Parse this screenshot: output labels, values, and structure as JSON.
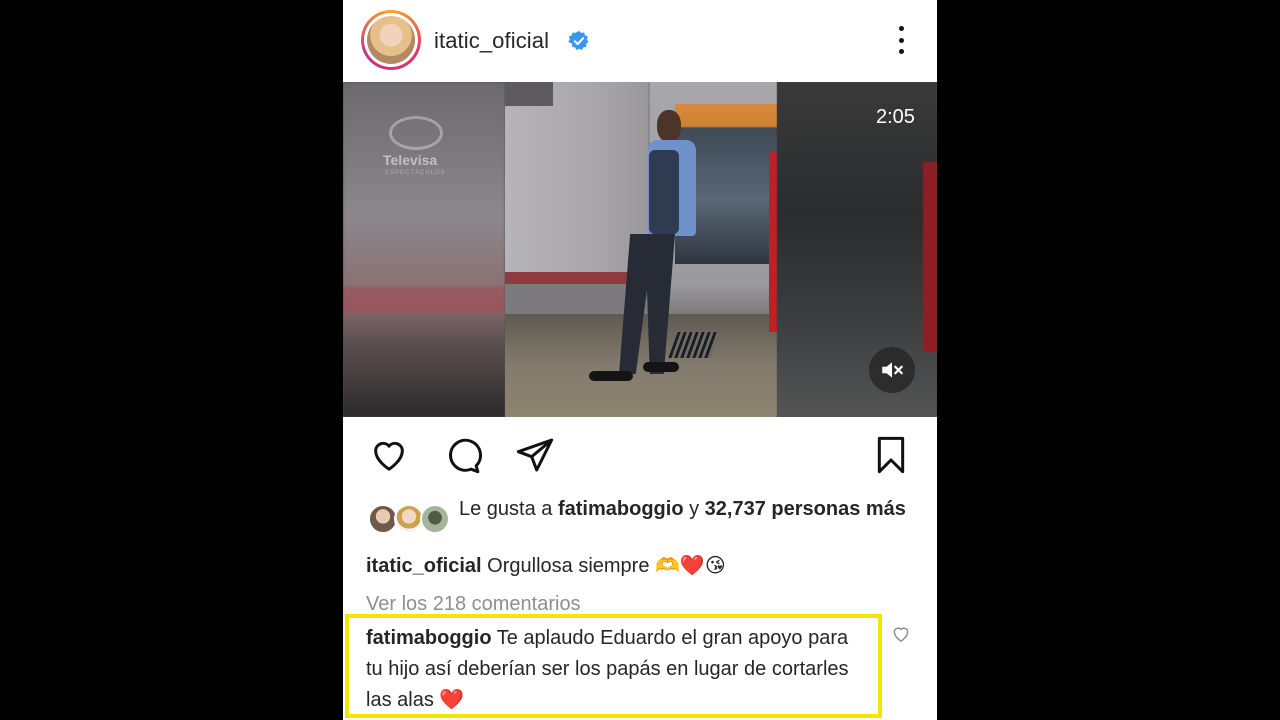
{
  "post": {
    "username": "itatic_oficial",
    "verified": true
  },
  "video": {
    "duration": "2:05",
    "watermark": {
      "brand": "Televisa",
      "sub": "ESPECTÁCULOS"
    },
    "muted": true
  },
  "actions": {
    "icons": [
      "heart-icon",
      "comment-icon",
      "share-icon",
      "bookmark-icon"
    ]
  },
  "likes": {
    "prefix": "Le gusta a",
    "user": "fatimaboggio",
    "connector": "y",
    "count": "32,737 personas más"
  },
  "caption": {
    "user": "itatic_oficial",
    "text": "Orgullosa siempre",
    "emojis": "🫶❤️😘"
  },
  "view_comments": "Ver los 218 comentarios",
  "comment": {
    "user": "fatimaboggio",
    "text": "Te aplaudo Eduardo el gran apoyo para tu hijo así deberían ser los papás en lugar de cortarles las alas",
    "emoji": "❤️"
  },
  "colors": {
    "verified": "#3897f0",
    "highlight": "#f4e600",
    "muted_text": "#8e8e8e"
  }
}
